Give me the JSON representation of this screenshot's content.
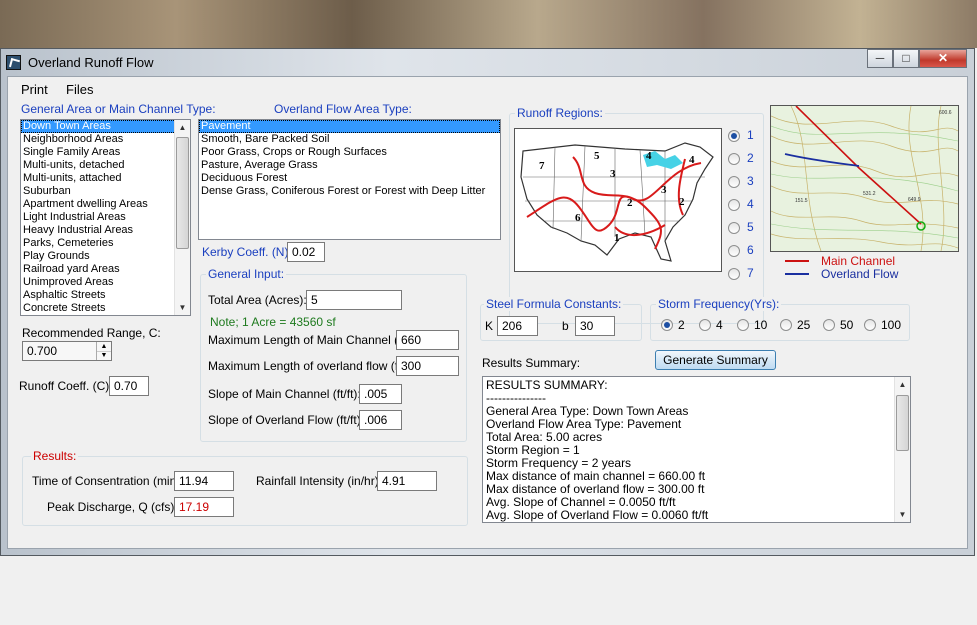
{
  "window": {
    "title": "Overland Runoff Flow",
    "controls": [
      "─",
      "□",
      "✕"
    ]
  },
  "menu": {
    "items": [
      "Print",
      "Files"
    ]
  },
  "general_area": {
    "label": "General Area or Main Channel Type:",
    "items": [
      "Down Town Areas",
      "Neighborhood Areas",
      "Single Family Areas",
      "Multi-units, detached",
      "Multi-units, attached",
      "Suburban",
      "Apartment dwelling Areas",
      "Light Industrial Areas",
      "Heavy Industrial Areas",
      "Parks, Cemeteries",
      "Play Grounds",
      "Railroad yard Areas",
      "Unimproved Areas",
      "Asphaltic Streets",
      "Concrete Streets"
    ],
    "selected_index": 0
  },
  "overland_flow": {
    "label": "Overland Flow Area Type:",
    "items": [
      "Pavement",
      "Smooth, Bare Packed Soil",
      "Poor Grass, Crops or Rough Surfaces",
      "Pasture, Average Grass",
      "Deciduous Forest",
      "Dense Grass, Coniferous Forest or Forest with Deep Litter"
    ],
    "selected_index": 0
  },
  "kerby": {
    "label": "Kerby Coeff. (N):",
    "value": "0.02"
  },
  "recommended": {
    "label": "Recommended Range, C:",
    "value": "0.700"
  },
  "runoff_coeff": {
    "label": "Runoff Coeff. (C):",
    "value": "0.70"
  },
  "general_input": {
    "label": "General Input:",
    "total_area_label": "Total Area (Acres):",
    "total_area": "5",
    "note": "Note; 1 Acre = 43560 sf",
    "max_main_label": "Maximum Length of Main Channel (ft):",
    "max_main": "660",
    "max_overland_label": "Maximum Length of overland flow (ft):",
    "max_overland": "300",
    "slope_main_label": "Slope of Main Channel (ft/ft):",
    "slope_main": ".005",
    "slope_overland_label": "Slope of Overland Flow (ft/ft):",
    "slope_overland": ".006"
  },
  "runoff_regions": {
    "label": "Runoff Regions:",
    "options": [
      "1",
      "2",
      "3",
      "4",
      "5",
      "6",
      "7"
    ],
    "selected": "1",
    "map_labels": [
      "7",
      "5",
      "4",
      "4",
      "3",
      "3",
      "6",
      "2",
      "2",
      "1"
    ]
  },
  "legend": {
    "main_channel": "Main Channel",
    "overland_flow": "Overland Flow",
    "main_color": "#cc1111",
    "overland_color": "#1a2fa0"
  },
  "topo": {
    "labels": [
      "600.6",
      "151.5",
      "531.2",
      "649.9"
    ]
  },
  "steel": {
    "label": "Steel Formula Constants:",
    "k_label": "K",
    "k": "206",
    "b_label": "b",
    "b": "30"
  },
  "storm": {
    "label": "Storm Frequency(Yrs):",
    "options": [
      "2",
      "4",
      "10",
      "25",
      "50",
      "100"
    ],
    "selected": "2"
  },
  "results_summary": {
    "label": "Results Summary:",
    "button": "Generate Summary",
    "lines": [
      "RESULTS SUMMARY:",
      "---------------",
      "General Area Type: Down Town Areas",
      "Overland Flow Area Type: Pavement",
      "Total Area: 5.00 acres",
      "Storm Region = 1",
      "Storm Frequency = 2 years",
      "Max distance of main channel = 660.00 ft",
      "Max distance of overland flow = 300.00 ft",
      "Avg. Slope of Channel = 0.0050 ft/ft",
      "Avg. Slope of Overland Flow = 0.0060 ft/ft"
    ]
  },
  "results": {
    "label": "Results:",
    "tc_label": "Time of Consentration (min):",
    "tc": "11.94",
    "ri_label": "Rainfall Intensity (in/hr):",
    "ri": "4.91",
    "q_label": "Peak Discharge, Q (cfs):",
    "q": "17.19",
    "q_color": "#cc0000"
  }
}
